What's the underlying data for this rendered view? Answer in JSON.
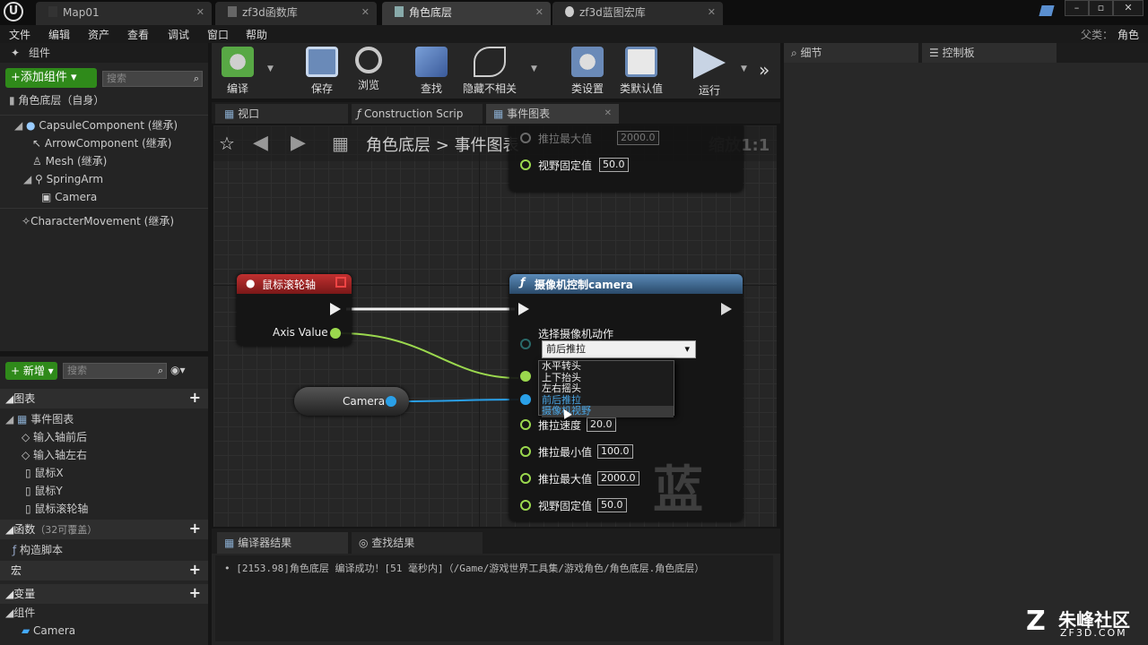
{
  "tabs": [
    {
      "label": "Map01"
    },
    {
      "label": "zf3d函数库"
    },
    {
      "label": "角色底层"
    },
    {
      "label": "zf3d蓝图宏库"
    }
  ],
  "parent_label": "父类：",
  "parent_value": "角色",
  "menu": [
    "文件",
    "编辑",
    "资产",
    "查看",
    "调试",
    "窗口",
    "帮助"
  ],
  "components": {
    "title": "组件",
    "add_button": "+添加组件 ▾",
    "search_placeholder": "搜索",
    "root": "角色底层（自身）",
    "items": [
      "CapsuleComponent (继承)",
      "ArrowComponent (继承)",
      "Mesh (继承)",
      "SpringArm",
      "Camera",
      "CharacterMovement (继承)"
    ]
  },
  "mybp": {
    "new_button": "+ 新增 ▾",
    "search_placeholder": "搜索",
    "graphs": "图表",
    "event_graph": "事件图表",
    "events": [
      "输入轴前后",
      "输入轴左右",
      "鼠标X",
      "鼠标Y",
      "鼠标滚轮轴"
    ],
    "functions": "函数",
    "functions_note": "（32可覆盖）",
    "construct": "构造脚本",
    "macros": "宏",
    "variables": "变量",
    "vcomps": "组件",
    "vcamera": "Camera"
  },
  "toolbar": [
    "编译",
    "保存",
    "浏览",
    "查找",
    "隐藏不相关",
    "类设置",
    "类默认值",
    "运行"
  ],
  "doc_tabs": [
    "视口",
    "Construction Scrip",
    "事件图表"
  ],
  "breadcrumb": {
    "root": "角色底层",
    "sep": ">",
    "leaf": "事件图表",
    "zoom": "缩放1:1"
  },
  "upper_node": {
    "r1": "推拉最大值",
    "v1": "2000.0",
    "r2": "视野固定值",
    "v2": "50.0"
  },
  "event_node": {
    "title": "鼠标滚轮轴",
    "out": "Axis Value"
  },
  "camera_var": "Camera",
  "func_node": {
    "title": "摄像机控制camera",
    "sel_label": "选择摄像机动作",
    "selected": "前后推拉",
    "options": [
      "水平转头",
      "上下抬头",
      "左右摇头",
      "前后推拉",
      "摄像机视野"
    ],
    "r_speed": "推拉速度",
    "v_speed": "20.0",
    "r_min": "推拉最小值",
    "v_min": "100.0",
    "r_max": "推拉最大值",
    "v_max": "2000.0",
    "r_fov": "视野固定值",
    "v_fov": "50.0"
  },
  "watermark": "蓝图",
  "right_tabs": [
    "细节",
    "控制板"
  ],
  "bottom": {
    "tab1": "编译器结果",
    "tab2": "查找结果",
    "log": "[2153.98]角色底层 编译成功！[51 毫秒内]（/Game/游戏世界工具集/游戏角色/角色底层.角色底层）"
  },
  "brand": {
    "name": "朱峰社区",
    "url": "ZF3D.COM"
  }
}
